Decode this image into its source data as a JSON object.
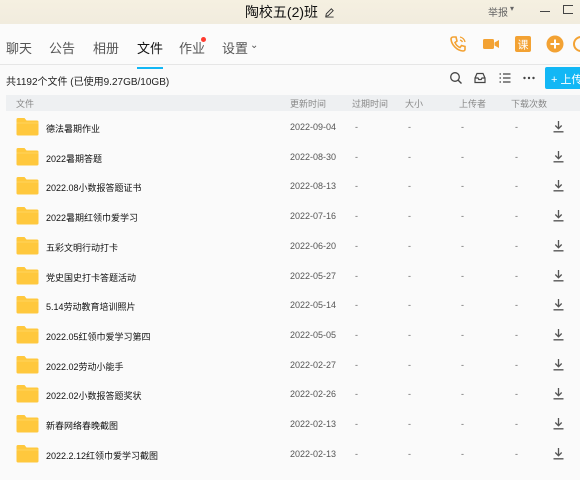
{
  "window": {
    "title": "陶校五(2)班",
    "report_label": "举报"
  },
  "tabs": [
    {
      "label": "聊天"
    },
    {
      "label": "公告"
    },
    {
      "label": "相册"
    },
    {
      "label": "文件"
    },
    {
      "label": "作业"
    },
    {
      "label": "设置"
    }
  ],
  "active_tab": "文件",
  "toolbar": {
    "summary": "共1192个文件 (已使用9.27GB/10GB)",
    "upload_label": "+ 上传"
  },
  "table": {
    "columns": [
      "文件",
      "更新时间",
      "过期时间",
      "大小",
      "上传者",
      "下载次数"
    ],
    "rows": [
      {
        "name": "德法暑期作业",
        "date": "2022-09-04",
        "expire": "-",
        "size": "-",
        "uploader": "-",
        "downloads": "-"
      },
      {
        "name": "2022暑期答题",
        "date": "2022-08-30",
        "expire": "-",
        "size": "-",
        "uploader": "-",
        "downloads": "-"
      },
      {
        "name": "2022.08小数报答题证书",
        "date": "2022-08-13",
        "expire": "-",
        "size": "-",
        "uploader": "-",
        "downloads": "-"
      },
      {
        "name": "2022暑期红领巾爱学习",
        "date": "2022-07-16",
        "expire": "-",
        "size": "-",
        "uploader": "-",
        "downloads": "-"
      },
      {
        "name": "五彩文明行动打卡",
        "date": "2022-06-20",
        "expire": "-",
        "size": "-",
        "uploader": "-",
        "downloads": "-"
      },
      {
        "name": "党史国史打卡答题活动",
        "date": "2022-05-27",
        "expire": "-",
        "size": "-",
        "uploader": "-",
        "downloads": "-"
      },
      {
        "name": "5.14劳动教育培训照片",
        "date": "2022-05-14",
        "expire": "-",
        "size": "-",
        "uploader": "-",
        "downloads": "-"
      },
      {
        "name": "2022.05红领巾爱学习第四",
        "date": "2022-05-05",
        "expire": "-",
        "size": "-",
        "uploader": "-",
        "downloads": "-"
      },
      {
        "name": "2022.02劳动小能手",
        "date": "2022-02-27",
        "expire": "-",
        "size": "-",
        "uploader": "-",
        "downloads": "-"
      },
      {
        "name": "2022.02小数报答题奖状",
        "date": "2022-02-26",
        "expire": "-",
        "size": "-",
        "uploader": "-",
        "downloads": "-"
      },
      {
        "name": "新春网络春晚截图",
        "date": "2022-02-13",
        "expire": "-",
        "size": "-",
        "uploader": "-",
        "downloads": "-"
      },
      {
        "name": "2022.2.12红领巾爱学习截图",
        "date": "2022-02-13",
        "expire": "-",
        "size": "-",
        "uploader": "-",
        "downloads": "-"
      }
    ]
  },
  "icons": {
    "folder": "folder-icon",
    "download": "download-icon",
    "phone": "phone-icon",
    "video": "video-icon",
    "classroom": "classroom-icon",
    "add": "add-circle-icon",
    "settings": "gear-icon"
  },
  "colors": {
    "accent": "#12b7f5",
    "folder": "#ffc83d",
    "brand_orange": "#f3a233",
    "badge": "#ff3b30"
  }
}
